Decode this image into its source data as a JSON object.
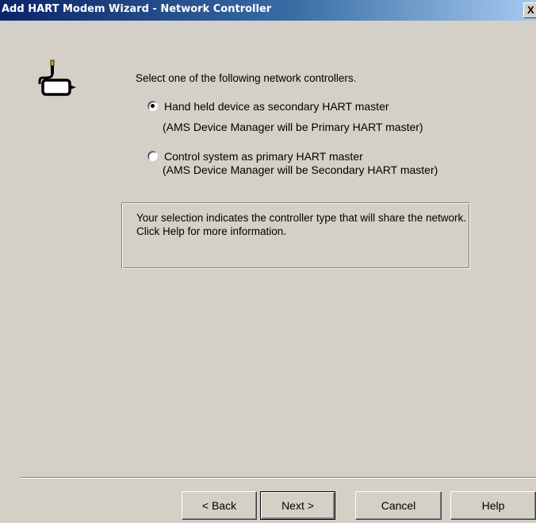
{
  "window": {
    "title": "Add HART Modem Wizard - Network Controller",
    "close_label": "X"
  },
  "icons": {
    "wizard": "hart-modem-connector-icon"
  },
  "main": {
    "instruction": "Select one of the following network controllers.",
    "options": [
      {
        "label": "Hand held device as secondary HART master",
        "note": "(AMS Device Manager will be Primary HART master)",
        "selected": true
      },
      {
        "label": "Control system as primary HART master",
        "note": "(AMS Device Manager will be Secondary HART master)",
        "selected": false
      }
    ],
    "info": "Your selection indicates the controller type that will share the network. Click Help for more information."
  },
  "buttons": {
    "back": "< Back",
    "next": "Next >",
    "cancel": "Cancel",
    "help": "Help"
  }
}
